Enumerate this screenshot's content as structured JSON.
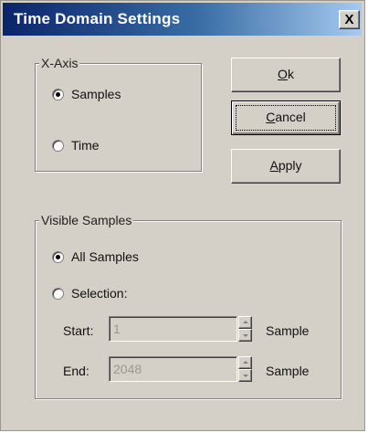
{
  "window": {
    "title": "Time Domain Settings",
    "close_label": "X"
  },
  "x_axis": {
    "group_label": "X-Axis",
    "options": [
      {
        "label": "Samples",
        "selected": true
      },
      {
        "label": "Time",
        "selected": false
      }
    ]
  },
  "buttons": {
    "ok": {
      "prefix": "",
      "accel": "O",
      "rest": "k"
    },
    "cancel": {
      "prefix": "",
      "accel": "C",
      "rest": "ancel"
    },
    "apply": {
      "prefix": "",
      "accel": "A",
      "rest": "pply"
    }
  },
  "visible_samples": {
    "group_label": "Visible Samples",
    "options": [
      {
        "label": "All Samples",
        "selected": true
      },
      {
        "label": "Selection:",
        "selected": false
      }
    ],
    "start": {
      "label": "Start:",
      "value": "1",
      "unit": "Sample"
    },
    "end": {
      "label": "End:",
      "value": "2048",
      "unit": "Sample"
    }
  },
  "colors": {
    "face": "#d4d0c8",
    "title_gradient_start": "#0a246a",
    "title_gradient_end": "#a6caf0",
    "disabled_text": "#9a988f"
  }
}
